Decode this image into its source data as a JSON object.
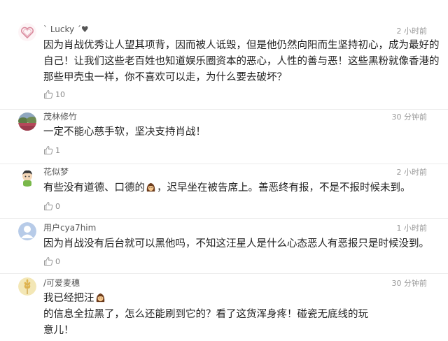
{
  "comments": [
    {
      "username": "ˋ Lucky ˊ♥",
      "time": "2 小时前",
      "lines": [
        "因为肖战优秀让人望其项背，因而被人诋毁，但是他仍然向阳而生坚持初心，成为最好的",
        "自己！让我们这些老百姓也知道娱乐圈资本的恶心，人性的善与恶！这些黑粉就像香港的",
        "那些甲壳虫一样，你不喜欢可以走，为什么要去破坏？"
      ],
      "likes": "10"
    },
    {
      "username": "茂林修竹",
      "time": "30 分钟前",
      "text": "一定不能心慈手软，坚决支持肖战！",
      "likes": "1"
    },
    {
      "username": "花似梦",
      "time": "2 小时前",
      "text_before": "有些没有道德、口德的",
      "text_after": "，迟早坐在被告席上。善恶终有报，不是不报时候未到。",
      "likes": "0"
    },
    {
      "username": "用户cya7him",
      "time": "1 小时前",
      "text": "因为肖战没有后台就可以黑他吗，不知这汪星人是什么心态恶人有恶报只是时候没到。",
      "likes": "0"
    },
    {
      "username": "/可爱麦穗",
      "time": "30 分钟前",
      "line1_before": "我已经把汪",
      "line1_after": "的信息全拉黑了，怎么还能刷到它的？看了这货浑身疼！碰瓷无底线的玩",
      "line2": "意儿！",
      "likes": "0"
    }
  ],
  "icons": {
    "like": "thumbs-up-icon",
    "emoji": "woman-face-emoji"
  },
  "colors": {
    "username": "#555555",
    "timestamp": "#999999",
    "text": "#1f1f1f",
    "divider": "#ececec"
  }
}
